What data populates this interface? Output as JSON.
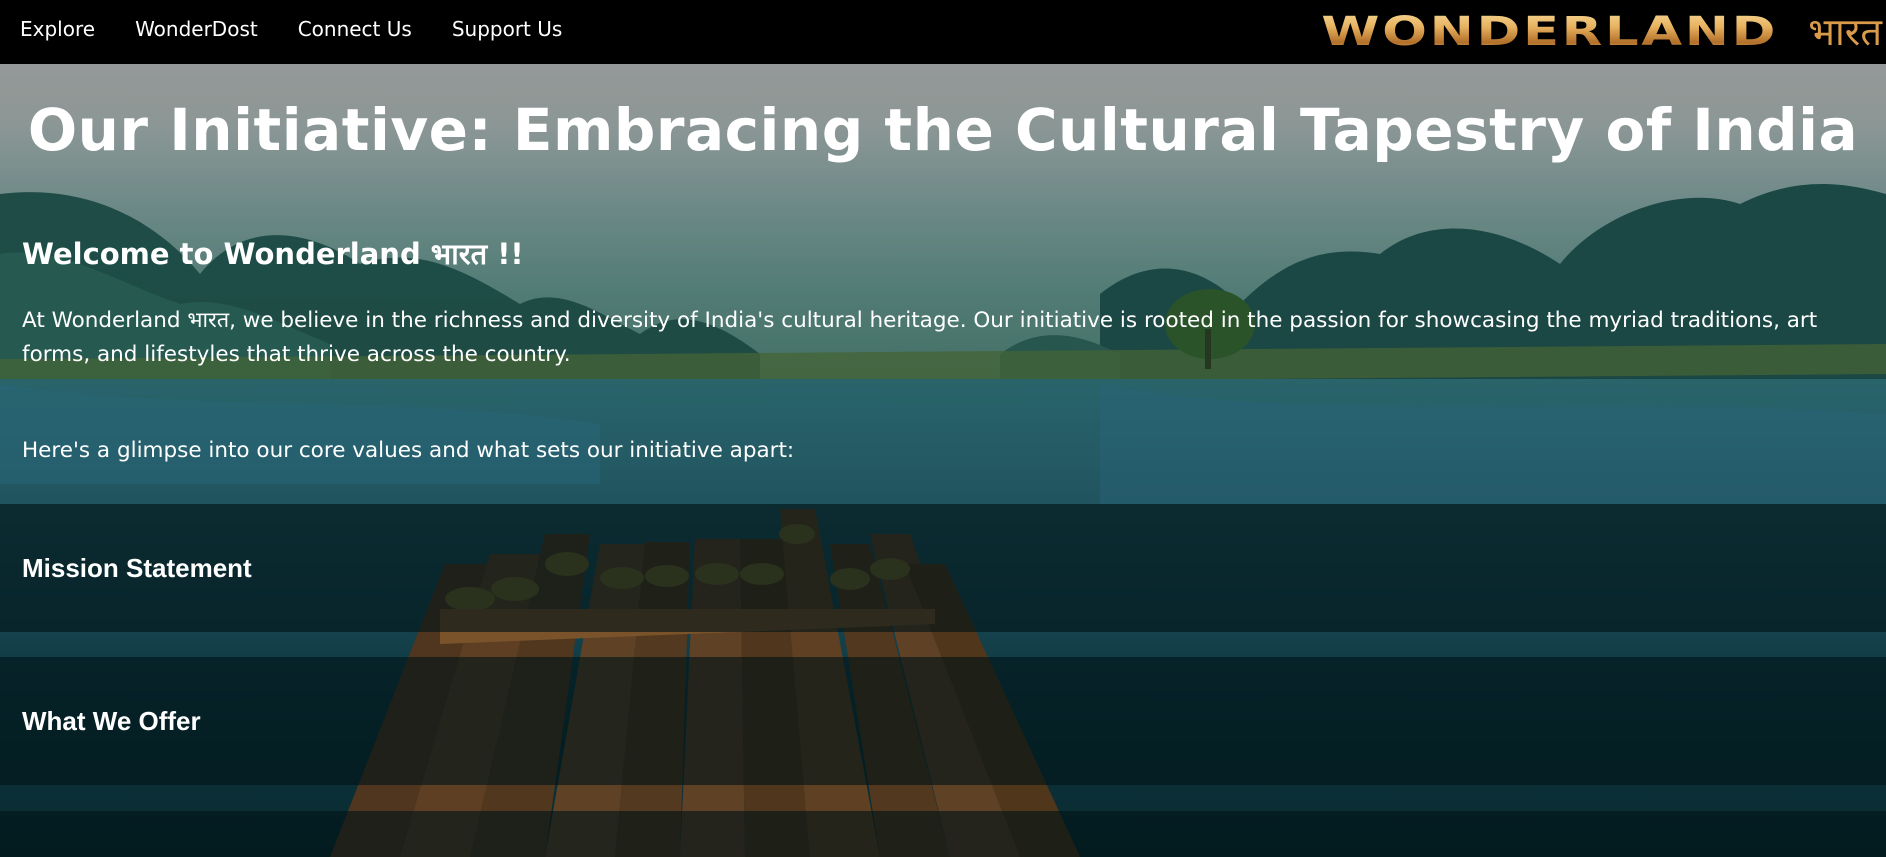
{
  "nav": {
    "links": [
      "Explore",
      "WonderDost",
      "Connect Us",
      "Support Us"
    ],
    "brand_latin": "WONDERLAND",
    "brand_devanagari": "भारत"
  },
  "hero": {
    "title": "Our Initiative: Embracing the Cultural Tapestry of India",
    "welcome_heading": "Welcome to Wonderland भारत !!",
    "intro": "At Wonderland भारत, we believe in the richness and diversity of India's cultural heritage. Our initiative is rooted in the passion for showcasing the myriad traditions, art forms, and lifestyles that thrive across the country.",
    "glimpse": "Here's a glimpse into our core values and what sets our initiative apart:"
  },
  "sections": [
    {
      "title": "Mission Statement"
    },
    {
      "title": "What We Offer"
    }
  ],
  "colors": {
    "navbar_bg": "#000000",
    "brand_gold": "#e7b25f",
    "text": "#ffffff",
    "band_overlay": "rgba(0,20,22,0.62)"
  }
}
